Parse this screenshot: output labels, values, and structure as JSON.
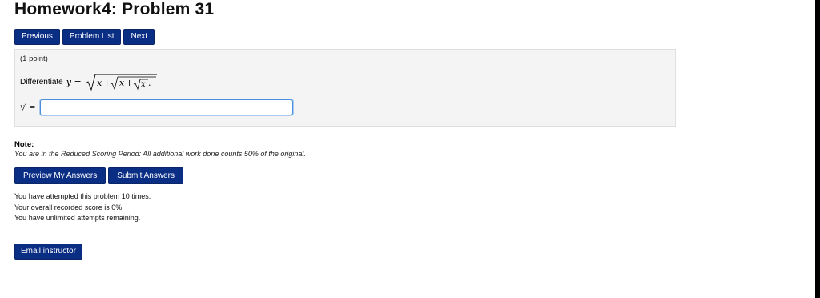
{
  "header": {
    "title": "Homework4: Problem 31"
  },
  "nav": {
    "previous": "Previous",
    "problem_list": "Problem List",
    "next": "Next"
  },
  "problem": {
    "points": "(1 point)",
    "prompt": "Differentiate",
    "equation_lhs": "y =",
    "equation_radicand": "x + √(x + √x).",
    "answer_label": "y′ =",
    "answer_value": ""
  },
  "note": {
    "title": "Note:",
    "text": "You are in the Reduced Scoring Period: All additional work done counts 50% of the original."
  },
  "actions": {
    "preview": "Preview My Answers",
    "submit": "Submit Answers"
  },
  "status": {
    "attempts": "You have attempted this problem 10 times.",
    "score": "Your overall recorded score is 0%.",
    "remaining": "You have unlimited attempts remaining."
  },
  "footer": {
    "email": "Email instructor"
  },
  "colors": {
    "button_bg": "#0b2e85",
    "panel_bg": "#f4f4f4",
    "input_focus": "#4a8fdc"
  }
}
